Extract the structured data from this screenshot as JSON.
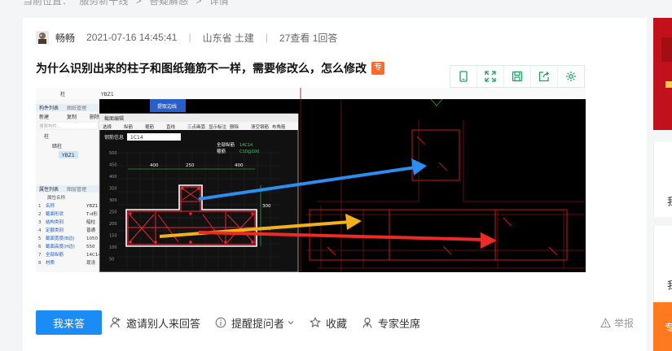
{
  "breadcrumb": [
    "当前位置：",
    "服务新干线",
    ">",
    "答疑解惑",
    ">",
    "详情"
  ],
  "question": {
    "author": "畅畅",
    "datetime": "2021-07-16 14:45:41",
    "location": "山东省  土建",
    "stats": "27查看  1回答",
    "separator": "|",
    "title": "为什么识别出来的柱子和图纸箍筋不一样，需要修改么，怎么修改",
    "badge": "专"
  },
  "toolbar": {
    "icons": [
      "tablet-icon",
      "expand-icon",
      "save-icon",
      "share-icon",
      "settings-icon"
    ],
    "accent_color": "#1aa260"
  },
  "figure": {
    "layer_select": "柱",
    "component_select": "YBZ1",
    "recognize_button": "提取边线",
    "tabs": [
      "构件列表",
      "图纸管理"
    ],
    "tree_actions": [
      "新建",
      "复制",
      "删除"
    ],
    "search_placeholder": "搜索构件...",
    "tree": [
      "柱",
      "暗柱",
      "YBZ1"
    ],
    "dialog_title": "截面编辑",
    "dialog_toolbar": [
      "选择",
      "纵筋",
      "箍筋",
      "直线",
      "三点画弧",
      "显示标注",
      "删除",
      "清空钢筋",
      "布角筋"
    ],
    "rebar_label": "钢筋信息",
    "rebar_value": "1C14",
    "dims_top": [
      "400",
      "250",
      "400"
    ],
    "dims_right": [
      "300",
      "250"
    ],
    "dims_left": [
      "500",
      "450",
      "400",
      "350",
      "300",
      "250",
      "200",
      "150",
      "100",
      "50"
    ],
    "annotation_full": "全部纵筋",
    "annotation_stirrup": "箍筋",
    "annotation_green1": "14C14",
    "annotation_green2": "C10@100",
    "props_tabs": [
      "属性列表",
      "图层管理"
    ],
    "props_header": "属性名称",
    "props": [
      {
        "n": "1",
        "name": "名称",
        "val": "YBZ1"
      },
      {
        "n": "2",
        "name": "截面形状",
        "val": "T-d形"
      },
      {
        "n": "3",
        "name": "结构类别",
        "val": "暗柱"
      },
      {
        "n": "4",
        "name": "定额类别",
        "val": "普通"
      },
      {
        "n": "5",
        "name": "截面宽度(B边)",
        "val": "1050"
      },
      {
        "n": "6",
        "name": "截面高度(H边)",
        "val": "550"
      },
      {
        "n": "7",
        "name": "全部纵筋",
        "val": "14C14"
      },
      {
        "n": "8",
        "name": "材质",
        "val": "现浇"
      }
    ],
    "arrow_colors": [
      "#2b8ef0",
      "#f2b01c",
      "#ee2a24"
    ]
  },
  "actions": {
    "answer_button": "我来答",
    "invite": "邀请别人来回答",
    "remind": "提醒提问者",
    "collect": "收藏",
    "expert": "专家坐席",
    "report": "举报"
  },
  "sidebar": {
    "card_char_1": "我",
    "card_char_2": "我",
    "bottom_char": "专"
  }
}
